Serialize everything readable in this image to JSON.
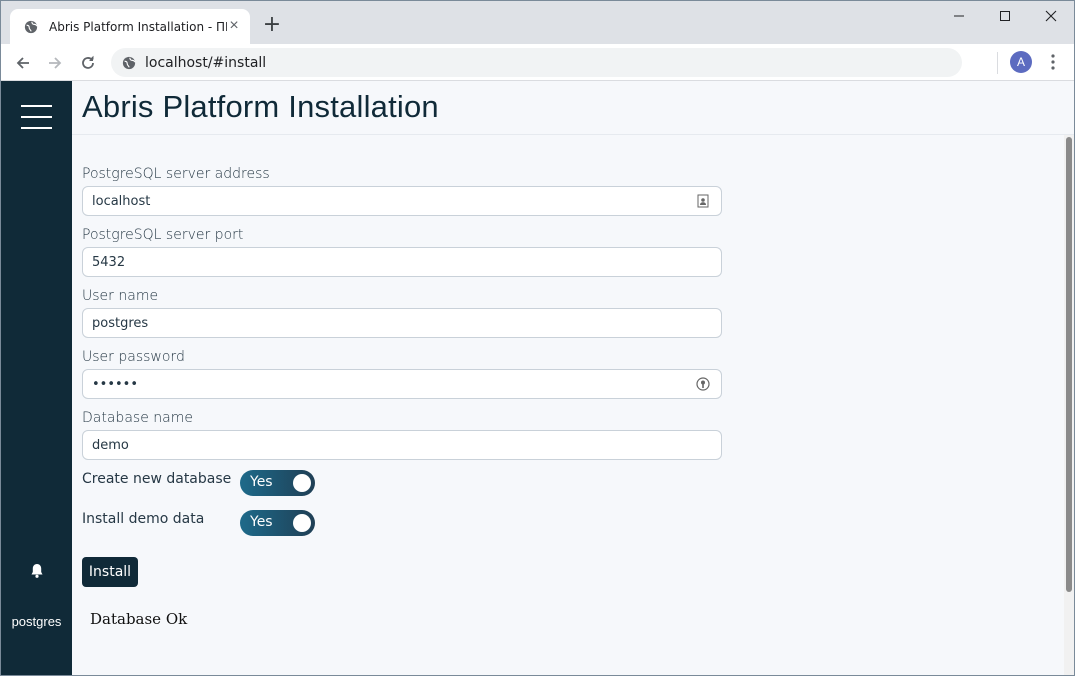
{
  "browser": {
    "tab_title": "Abris Platform Installation - ПК \"Абрис\"",
    "tab_close": "×",
    "new_tab": "+",
    "url": "localhost/#install",
    "avatar_letter": "A"
  },
  "sidebar": {
    "user": "postgres"
  },
  "page": {
    "title": "Abris Platform Installation"
  },
  "form": {
    "server_address_label": "PostgreSQL server address",
    "server_address_value": "localhost",
    "server_port_label": "PostgreSQL server port",
    "server_port_value": "5432",
    "user_name_label": "User name",
    "user_name_value": "postgres",
    "password_label": "User password",
    "password_value": "••••••",
    "database_name_label": "Database name",
    "database_name_value": "demo",
    "create_db_label": "Create new database",
    "create_db_toggle": "Yes",
    "demo_data_label": "Install demo data",
    "demo_data_toggle": "Yes",
    "install_button": "Install"
  },
  "status": {
    "message": "Database Ok"
  },
  "colors": {
    "sidebar": "#102a38",
    "accent": "#1e6a8a"
  }
}
